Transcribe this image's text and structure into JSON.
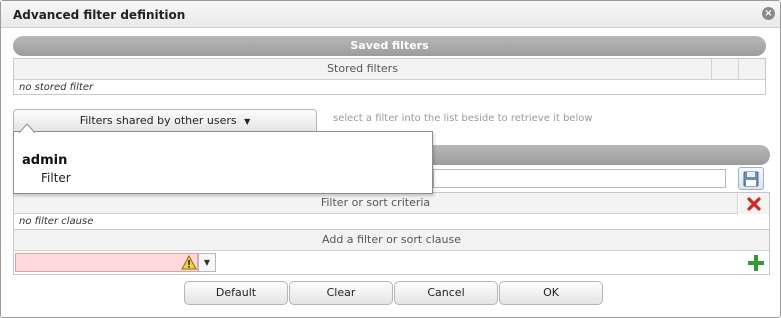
{
  "dialog": {
    "title": "Advanced filter definition",
    "close_icon": "close-icon"
  },
  "saved_filters": {
    "section_title": "Saved filters",
    "column_header": "Stored filters",
    "empty_text": "no stored filter"
  },
  "shared_filters": {
    "button_label": "Filters shared by other users",
    "hint": "select a filter into the list beside to retrieve it below",
    "dropdown": {
      "user": "admin",
      "filter_item": "Filter"
    }
  },
  "filter_criteria": {
    "column_header": "Filter or sort criteria",
    "empty_text": "no filter clause",
    "add_clause_header": "Add a filter or sort clause",
    "save_icon": "save-icon",
    "delete_icon": "delete-icon",
    "add_icon": "add-icon",
    "warning_icon": "warning-icon"
  },
  "buttons": {
    "default_label": "Default",
    "clear_label": "Clear",
    "cancel_label": "Cancel",
    "ok_label": "OK"
  },
  "colors": {
    "section_bar": "#a9a9a9",
    "invalid_field": "#ffd9d9",
    "delete_red": "#d9261c",
    "add_green": "#2e9e2e"
  }
}
